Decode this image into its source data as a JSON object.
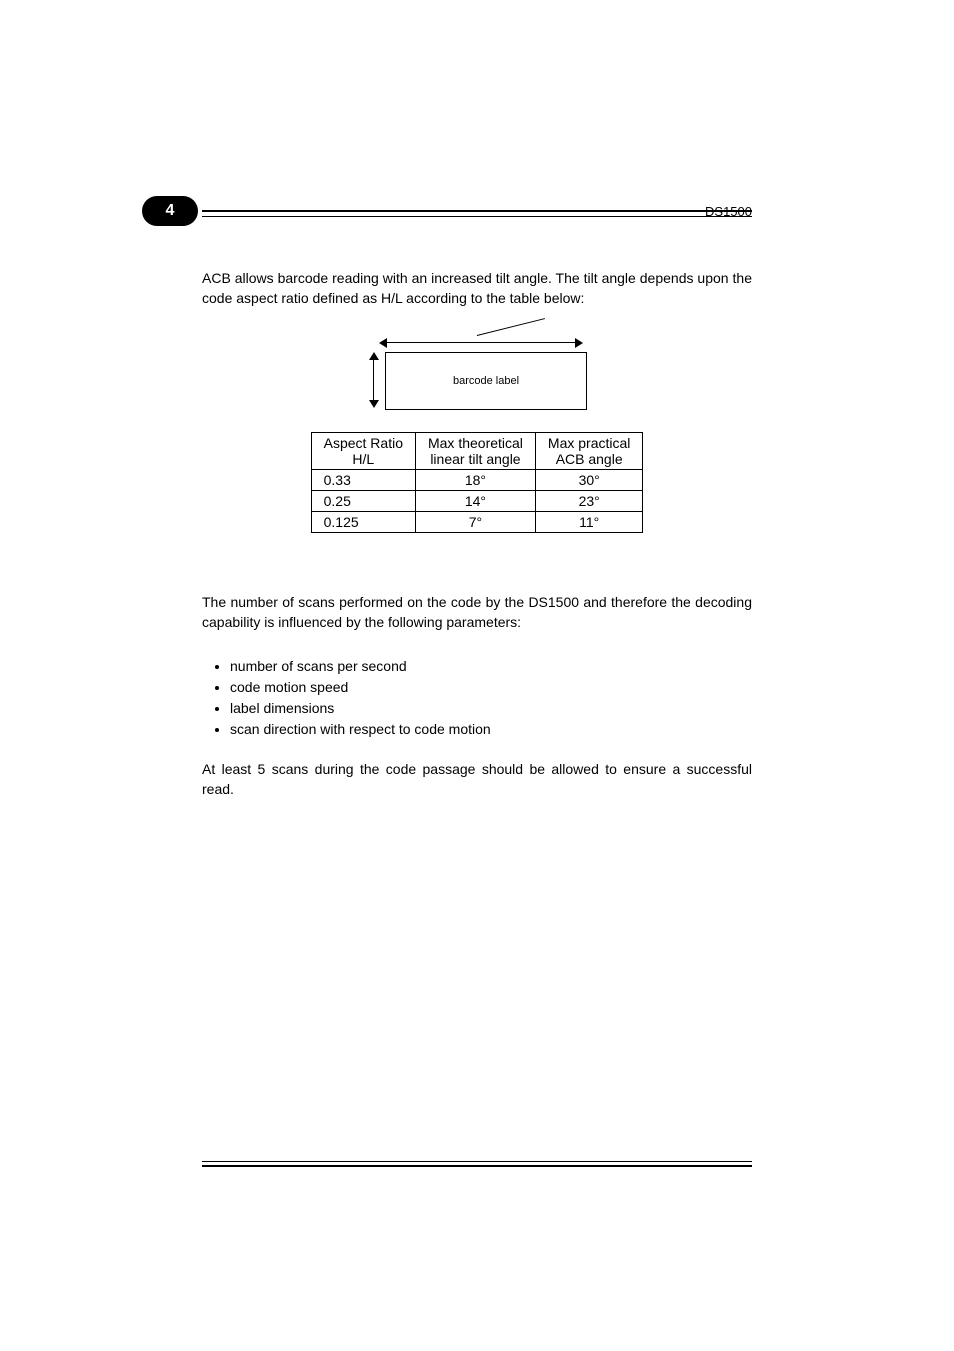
{
  "header": {
    "chapter": "4",
    "doc_id": "DS1500"
  },
  "intro_paragraph": "ACB allows barcode reading with an increased tilt angle. The tilt angle depends upon the code aspect ratio defined as H/L according to the table below:",
  "diagram": {
    "label": "barcode label"
  },
  "table": {
    "headers": {
      "col1_line1": "Aspect Ratio",
      "col1_line2": "H/L",
      "col2_line1": "Max theoretical",
      "col2_line2": "linear tilt angle",
      "col3_line1": "Max practical",
      "col3_line2": "ACB angle"
    },
    "rows": [
      {
        "ratio": "0.33",
        "theoretical": "18°",
        "practical": "30°"
      },
      {
        "ratio": "0.25",
        "theoretical": "14°",
        "practical": "23°"
      },
      {
        "ratio": "0.125",
        "theoretical": "7°",
        "practical": "11°"
      }
    ]
  },
  "section2_paragraph": "The number of scans performed on the code by the DS1500 and therefore the decoding capability is influenced by the following parameters:",
  "bullets": [
    "number of scans per second",
    "code motion speed",
    "label dimensions",
    "scan direction with respect to code motion"
  ],
  "closing_paragraph": "At least 5 scans during the code passage should be allowed to ensure a successful read."
}
